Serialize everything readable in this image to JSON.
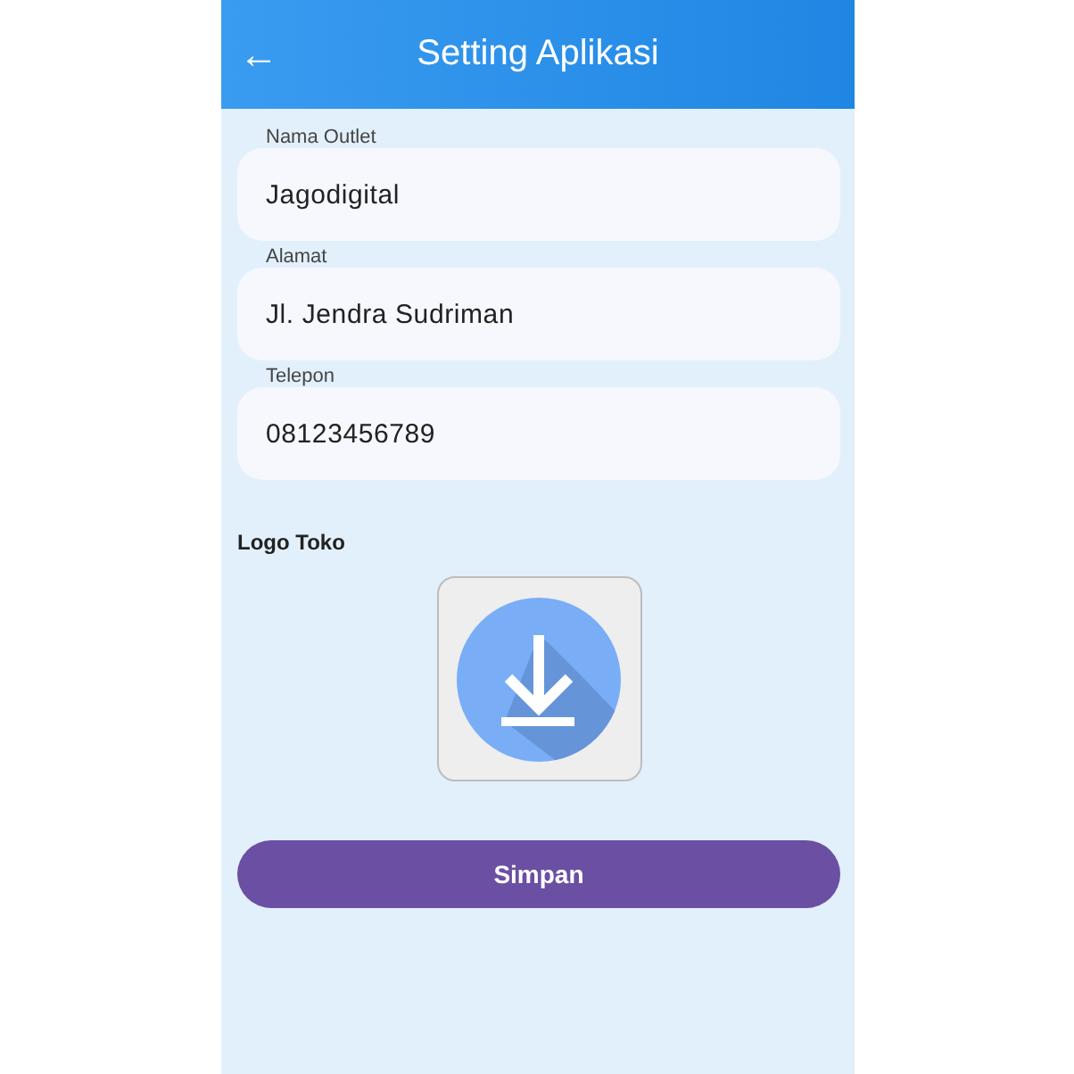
{
  "app_bar": {
    "back_icon": "←",
    "title": "Setting Aplikasi"
  },
  "fields": [
    {
      "label": "Nama Outlet",
      "value": "Jagodigital"
    },
    {
      "label": "Alamat",
      "value": "Jl. Jendra Sudriman"
    },
    {
      "label": "Telepon",
      "value": "08123456789"
    }
  ],
  "logo": {
    "label": "Logo Toko"
  },
  "save_button": "Simpan"
}
